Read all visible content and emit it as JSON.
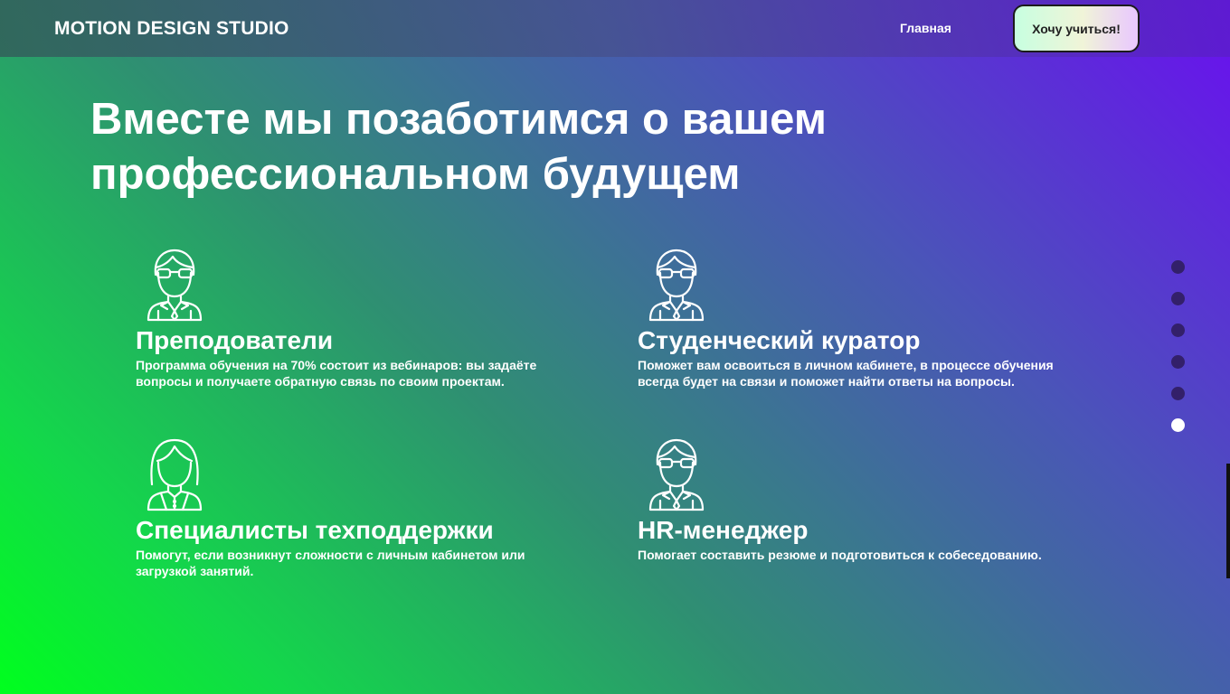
{
  "header": {
    "logo": "MOTION DESIGN STUDIO",
    "nav_home": "Главная",
    "cta_label": "Хочу учиться!"
  },
  "hero": {
    "title": "Вместе мы позаботимся о вашем профессиональном будущем"
  },
  "cards": [
    {
      "icon": "teacher-glasses-icon",
      "title": "Преподователи",
      "text": "Программа обучения на 70% состоит из вебинаров: вы задаёте вопросы и получаете обратную связь по своим проектам."
    },
    {
      "icon": "curator-glasses-icon",
      "title": "Студенческий куратор",
      "text": "Поможет вам освоиться в личном кабинете, в процессе обучения всегда будет на связи и поможет найти ответы на вопросы."
    },
    {
      "icon": "support-woman-icon",
      "title": "Специалисты техподдержки",
      "text": "Помогут, если возникнут сложности с личным кабинетом или загрузкой занятий."
    },
    {
      "icon": "hr-manager-icon",
      "title": "HR-менеджер",
      "text": "Помогает составить резюме и подготовиться к собеседованию."
    }
  ],
  "pagination": {
    "total": 6,
    "active_index": 5
  },
  "colors": {
    "gradient_top_right": "#6a0ff0",
    "gradient_bottom_left": "#00ff1e",
    "dot_inactive": "#33206a",
    "dot_active": "#ffffff",
    "cta_border": "#1b1b1b"
  }
}
